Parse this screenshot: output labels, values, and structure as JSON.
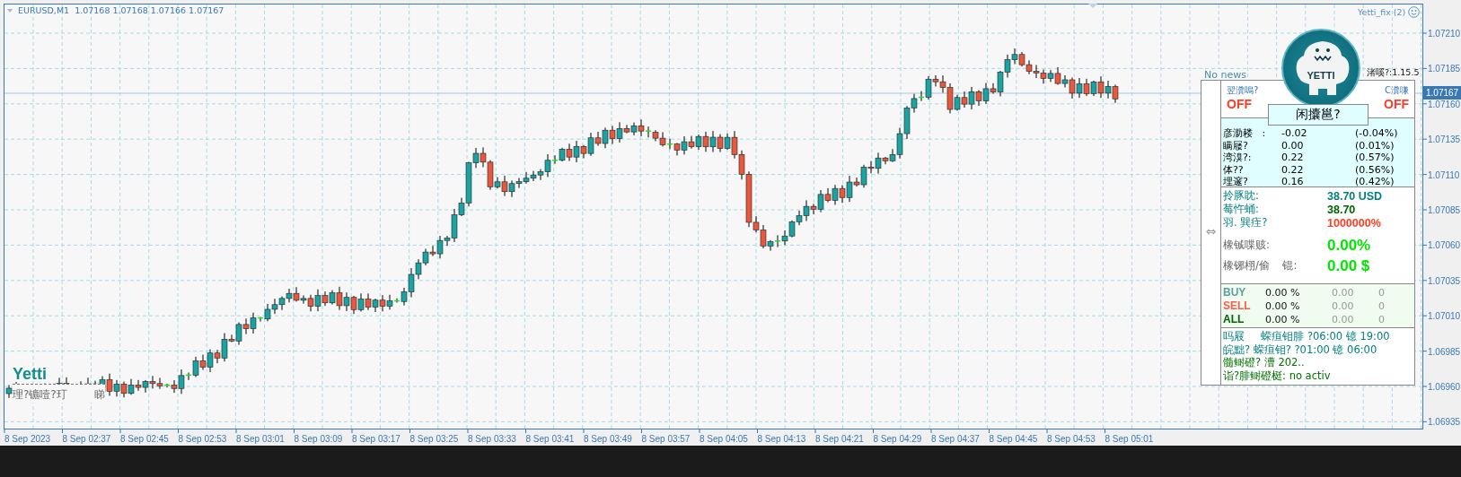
{
  "chart": {
    "symbol_line": "EURUSD,M1  1.07168 1.07168 1.07166 1.07167",
    "indicator_label": "Yetti_fix (2)",
    "current_price": "1.07167",
    "price_ticks": [
      "1.07210",
      "1.07185",
      "1.07160",
      "1.07135",
      "1.07110",
      "1.07085",
      "1.07060",
      "1.07035",
      "1.07010",
      "1.06985",
      "1.06960",
      "1.06935"
    ],
    "time_ticks": [
      "8 Sep 2023",
      "8 Sep 02:37",
      "8 Sep 02:45",
      "8 Sep 02:53",
      "8 Sep 03:01",
      "8 Sep 03:09",
      "8 Sep 03:17",
      "8 Sep 03:25",
      "8 Sep 03:33",
      "8 Sep 03:41",
      "8 Sep 03:49",
      "8 Sep 03:57",
      "8 Sep 04:05",
      "8 Sep 04:13",
      "8 Sep 04:21",
      "8 Sep 04:29",
      "8 Sep 04:37",
      "8 Sep 04:45",
      "8 Sep 04:53",
      "8 Sep 05:01"
    ]
  },
  "overlay": {
    "brand": "Yetti",
    "caption": "理?镳噎?玎        睇"
  },
  "panel": {
    "swap_icon": "⇔",
    "no_news": "No news",
    "version": "渚嗘?:1.15.5",
    "logo_text": "YETTI",
    "left_toggle": {
      "label": "翌瀵嗚?",
      "value": "OFF"
    },
    "right_toggle": {
      "label": "C瀵嗛",
      "value": "OFF"
    },
    "title": "闲攮邕?",
    "stats": [
      {
        "label": "彦泐耧   :",
        "value": "-0.02",
        "percent": "(-0.04%)"
      },
      {
        "label": "瞒屦?",
        "value": "0.00",
        "percent": "(0.01%)"
      },
      {
        "label": "湾溴?:",
        "value": "0.22",
        "percent": "(0.57%)"
      },
      {
        "label": "体??",
        "value": "0.22",
        "percent": "(0.56%)"
      },
      {
        "label": "埋邃?",
        "value": "0.16",
        "percent": "(0.42%)"
      }
    ],
    "account": [
      {
        "label": "拎豚眈:",
        "value": "38.70 USD",
        "kind": "normal",
        "color": "#007f7f"
      },
      {
        "label": "莓忤蛹:",
        "value": "38.70",
        "kind": "normal",
        "color": "#006400"
      },
      {
        "label": "羽. 巽疰?",
        "value": "1000000%",
        "kind": "normal",
        "color": "#ff3c1e"
      },
      {
        "label": "橡铖喋赅:",
        "value": "0.00%",
        "kind": "large",
        "color": "#00e600"
      },
      {
        "label": "橡铘栩/偷    锟:",
        "value": "0.00 $",
        "kind": "large",
        "color": "#00e600"
      }
    ],
    "trades": [
      {
        "side": "BUY",
        "percent": "0.00 %",
        "amount": "0.00",
        "count": "0",
        "color": "#5f9ea0"
      },
      {
        "side": "SELL",
        "percent": "0.00 %",
        "amount": "0.00",
        "count": "0",
        "color": "#ff5a4a"
      },
      {
        "side": "ALL",
        "percent": "0.00 %",
        "amount": "0.00",
        "count": "0",
        "color": "#006400"
      }
    ],
    "info": [
      {
        "text": "吗屐     蝾疸钼腓 ?06:00 镱 19:00",
        "color": "#007f7f"
      },
      {
        "text": "皖黜? 蝾疸钼? ?01:00 镱 06:00",
        "color": "#007f7f"
      },
      {
        "text": "髓鲥磴? 漕 202..",
        "color": "#007000"
      },
      {
        "text": "诣?腓鲥磴梃: no activ",
        "color": "#007000"
      }
    ]
  }
}
